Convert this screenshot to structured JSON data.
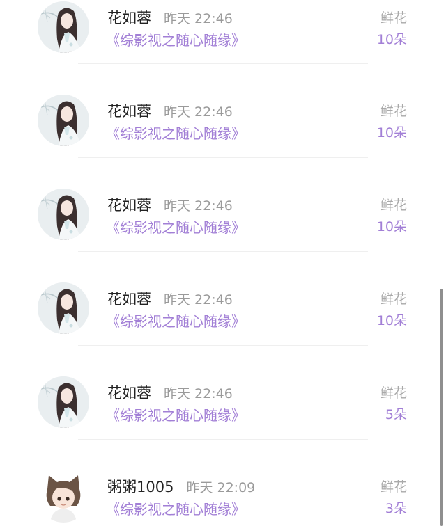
{
  "gift_list": [
    {
      "user": "花如蓉",
      "time": "昨天 22:46",
      "book": "《综影视之随心随缘》",
      "gift_type": "鲜花",
      "gift_count": "10朵",
      "avatar": "girl-avatar"
    },
    {
      "user": "花如蓉",
      "time": "昨天 22:46",
      "book": "《综影视之随心随缘》",
      "gift_type": "鲜花",
      "gift_count": "10朵",
      "avatar": "girl-avatar"
    },
    {
      "user": "花如蓉",
      "time": "昨天 22:46",
      "book": "《综影视之随心随缘》",
      "gift_type": "鲜花",
      "gift_count": "10朵",
      "avatar": "girl-avatar"
    },
    {
      "user": "花如蓉",
      "time": "昨天 22:46",
      "book": "《综影视之随心随缘》",
      "gift_type": "鲜花",
      "gift_count": "10朵",
      "avatar": "girl-avatar"
    },
    {
      "user": "花如蓉",
      "time": "昨天 22:46",
      "book": "《综影视之随心随缘》",
      "gift_type": "鲜花",
      "gift_count": "5朵",
      "avatar": "girl-avatar"
    },
    {
      "user": "粥粥1005",
      "time": "昨天 22:09",
      "book": "《综影视之随心随缘》",
      "gift_type": "鲜花",
      "gift_count": "3朵",
      "avatar": "boy-avatar"
    }
  ],
  "colors": {
    "accent_purple": "#a27fd6",
    "name_text": "#222222",
    "muted_text": "#9a9a9a"
  }
}
